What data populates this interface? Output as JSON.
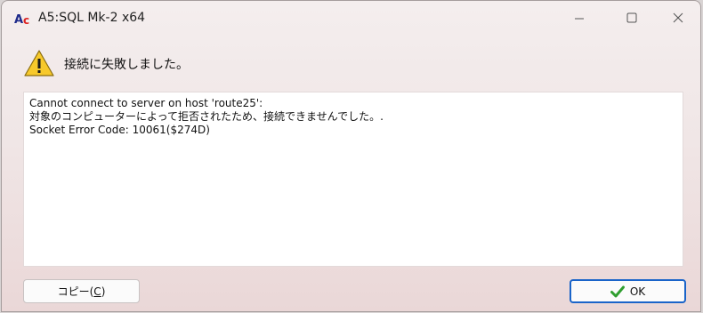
{
  "window": {
    "title": "A5:SQL Mk-2 x64",
    "icon": "a5sql-app-icon",
    "controls": {
      "minimize_icon": "minimize-icon",
      "maximize_icon": "maximize-icon",
      "close_icon": "close-icon"
    }
  },
  "dialog": {
    "icon": "warning-icon",
    "header": "接続に失敗しました。",
    "message_lines": [
      "Cannot connect to server on host 'route25':",
      "対象のコンピューターによって拒否されたため、接続できませんでした。.",
      "Socket Error Code: 10061($274D)"
    ]
  },
  "buttons": {
    "copy": {
      "label_main": "コピー(",
      "label_accel": "C",
      "label_end": ")"
    },
    "ok": {
      "label": "OK",
      "icon": "checkmark-icon",
      "icon_color": "#2f9e2f"
    }
  },
  "colors": {
    "warning_fill": "#f7c92b",
    "ok_border": "#1a64c9"
  }
}
